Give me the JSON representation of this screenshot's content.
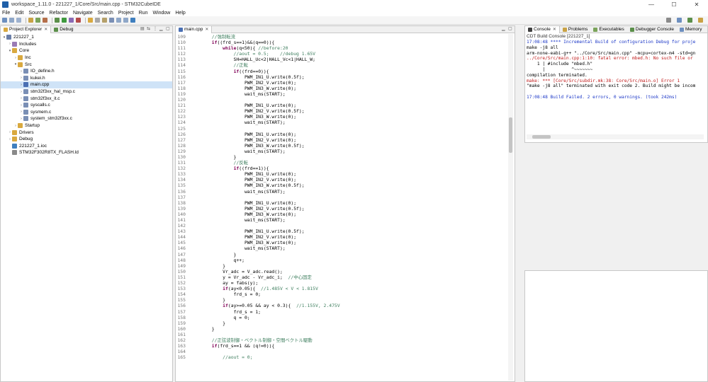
{
  "window": {
    "title": "workspace_1.11.0 - 221227_1/Core/Src/main.cpp - STM32CubeIDE",
    "minimize": "—",
    "maximize": "☐",
    "close": "✕"
  },
  "menu": [
    "File",
    "Edit",
    "Source",
    "Refactor",
    "Navigate",
    "Search",
    "Project",
    "Run",
    "Window",
    "Help"
  ],
  "explorer": {
    "tabs": [
      {
        "label": "Project Explorer"
      },
      {
        "label": "Debug"
      }
    ],
    "tree": [
      {
        "label": "221227_1",
        "depth": 0,
        "arrow": "▾",
        "icon": "project-icon",
        "color": "#6b7fa8"
      },
      {
        "label": "Includes",
        "depth": 1,
        "arrow": "›",
        "icon": "includes-icon",
        "color": "#9a7bb5"
      },
      {
        "label": "Core",
        "depth": 1,
        "arrow": "▾",
        "icon": "folder-icon",
        "color": "#d9a93f"
      },
      {
        "label": "Inc",
        "depth": 2,
        "arrow": "›",
        "icon": "folder-icon",
        "color": "#d9a93f"
      },
      {
        "label": "Src",
        "depth": 2,
        "arrow": "▾",
        "icon": "folder-icon",
        "color": "#d9a93f"
      },
      {
        "label": "IO_define.h",
        "depth": 3,
        "arrow": "›",
        "icon": "header-file-icon",
        "color": "#7a8fb5"
      },
      {
        "label": "kukei.h",
        "depth": 3,
        "arrow": "›",
        "icon": "header-file-icon",
        "color": "#7a8fb5"
      },
      {
        "label": "main.cpp",
        "depth": 3,
        "arrow": "›",
        "icon": "cpp-file-icon",
        "color": "#4a6fb3",
        "selected": true
      },
      {
        "label": "stm32f3xx_hal_msp.c",
        "depth": 3,
        "arrow": "›",
        "icon": "c-file-icon",
        "color": "#7a8fb5"
      },
      {
        "label": "stm32f3xx_it.c",
        "depth": 3,
        "arrow": "›",
        "icon": "c-file-icon",
        "color": "#7a8fb5"
      },
      {
        "label": "syscalls.c",
        "depth": 3,
        "arrow": "›",
        "icon": "c-file-icon",
        "color": "#7a8fb5"
      },
      {
        "label": "sysmem.c",
        "depth": 3,
        "arrow": "›",
        "icon": "c-file-icon",
        "color": "#7a8fb5"
      },
      {
        "label": "system_stm32f3xx.c",
        "depth": 3,
        "arrow": "›",
        "icon": "c-file-icon",
        "color": "#7a8fb5"
      },
      {
        "label": "Startup",
        "depth": 2,
        "arrow": "›",
        "icon": "folder-icon",
        "color": "#d9a93f"
      },
      {
        "label": "Drivers",
        "depth": 1,
        "arrow": "›",
        "icon": "folder-icon",
        "color": "#d9a93f"
      },
      {
        "label": "Debug",
        "depth": 1,
        "arrow": "›",
        "icon": "folder-icon",
        "color": "#d9a93f"
      },
      {
        "label": "221227_1.ioc",
        "depth": 1,
        "arrow": "",
        "icon": "ioc-file-icon",
        "color": "#3f7fbf"
      },
      {
        "label": "STM32F302R8TX_FLASH.ld",
        "depth": 1,
        "arrow": "",
        "icon": "ld-file-icon",
        "color": "#8a8a8a"
      }
    ]
  },
  "editor": {
    "tab": "main.cpp",
    "lines": [
      {
        "n": "109",
        "t": "        //強制転流",
        "k": "cm"
      },
      {
        "n": "110",
        "t": "        if((frd_s==1)&&(q==0)){",
        "k": "kw"
      },
      {
        "n": "111",
        "t": "            while(q<50){ //before:20",
        "k": "kw"
      },
      {
        "n": "112",
        "t": "                //aout = 0.5;    //debug 1.65V",
        "k": "cm"
      },
      {
        "n": "113",
        "t": "                SH=HALL_Uc<2|HALL_Vc<1|HALL_W;",
        "k": ""
      },
      {
        "n": "114",
        "t": "                //正転",
        "k": "cm"
      },
      {
        "n": "115",
        "t": "                if((frd==0)){",
        "k": "kw"
      },
      {
        "n": "116",
        "t": "                    PWM_IN1_U.write(0.5f);",
        "k": ""
      },
      {
        "n": "117",
        "t": "                    PWM_IN2_V.write(0);",
        "k": ""
      },
      {
        "n": "118",
        "t": "                    PWM_IN3_W.write(0);",
        "k": ""
      },
      {
        "n": "119",
        "t": "                    wait_ms(START);",
        "k": ""
      },
      {
        "n": "120",
        "t": "",
        "k": ""
      },
      {
        "n": "121",
        "t": "                    PWM_IN1_U.write(0);",
        "k": ""
      },
      {
        "n": "122",
        "t": "                    PWM_IN2_V.write(0.5f);",
        "k": ""
      },
      {
        "n": "123",
        "t": "                    PWM_IN3_W.write(0);",
        "k": ""
      },
      {
        "n": "124",
        "t": "                    wait_ms(START);",
        "k": ""
      },
      {
        "n": "125",
        "t": "",
        "k": ""
      },
      {
        "n": "126",
        "t": "                    PWM_IN1_U.write(0);",
        "k": ""
      },
      {
        "n": "127",
        "t": "                    PWM_IN2_V.write(0);",
        "k": ""
      },
      {
        "n": "128",
        "t": "                    PWM_IN3_W.write(0.5f);",
        "k": ""
      },
      {
        "n": "129",
        "t": "                    wait_ms(START);",
        "k": ""
      },
      {
        "n": "130",
        "t": "                }",
        "k": ""
      },
      {
        "n": "131",
        "t": "                //反転",
        "k": "cm"
      },
      {
        "n": "132",
        "t": "                if((frd==1)){",
        "k": "kw"
      },
      {
        "n": "133",
        "t": "                    PWM_IN1_U.write(0);",
        "k": ""
      },
      {
        "n": "134",
        "t": "                    PWM_IN2_V.write(0);",
        "k": ""
      },
      {
        "n": "135",
        "t": "                    PWM_IN3_W.write(0.5f);",
        "k": ""
      },
      {
        "n": "136",
        "t": "                    wait_ms(START);",
        "k": ""
      },
      {
        "n": "137",
        "t": "",
        "k": ""
      },
      {
        "n": "138",
        "t": "                    PWM_IN1_U.write(0);",
        "k": ""
      },
      {
        "n": "139",
        "t": "                    PWM_IN2_V.write(0.5f);",
        "k": ""
      },
      {
        "n": "140",
        "t": "                    PWM_IN3_W.write(0);",
        "k": ""
      },
      {
        "n": "141",
        "t": "                    wait_ms(START);",
        "k": ""
      },
      {
        "n": "142",
        "t": "",
        "k": ""
      },
      {
        "n": "143",
        "t": "                    PWM_IN1_U.write(0.5f);",
        "k": ""
      },
      {
        "n": "144",
        "t": "                    PWM_IN2_V.write(0);",
        "k": ""
      },
      {
        "n": "145",
        "t": "                    PWM_IN3_W.write(0);",
        "k": ""
      },
      {
        "n": "146",
        "t": "                    wait_ms(START);",
        "k": ""
      },
      {
        "n": "147",
        "t": "                }",
        "k": ""
      },
      {
        "n": "148",
        "t": "                q++;",
        "k": ""
      },
      {
        "n": "149",
        "t": "            }",
        "k": ""
      },
      {
        "n": "150",
        "t": "            Vr_adc = V_adc.read();",
        "k": ""
      },
      {
        "n": "151",
        "t": "            y = Vr_adc - Vr_adc_i;  //中心固定",
        "k": "mix"
      },
      {
        "n": "152",
        "t": "            ay = fabs(y);",
        "k": ""
      },
      {
        "n": "153",
        "t": "            if(ay<0.05){  //1.485V < V < 1.815V",
        "k": "mix"
      },
      {
        "n": "154",
        "t": "                frd_s = 0;",
        "k": ""
      },
      {
        "n": "155",
        "t": "            }",
        "k": ""
      },
      {
        "n": "156",
        "t": "            if(ay>=0.05 && ay < 0.3){  //1.155V, 2.475V",
        "k": "mix"
      },
      {
        "n": "157",
        "t": "                frd_s = 1;",
        "k": ""
      },
      {
        "n": "158",
        "t": "                q = 0;",
        "k": ""
      },
      {
        "n": "159",
        "t": "            }",
        "k": ""
      },
      {
        "n": "160",
        "t": "        }",
        "k": ""
      },
      {
        "n": "161",
        "t": "",
        "k": ""
      },
      {
        "n": "162",
        "t": "        //正弦波制御・ベクトル制御・空間ベクトル駆動",
        "k": "cm"
      },
      {
        "n": "163",
        "t": "        if(frd_s==1 && (q!=0)){",
        "k": "kw"
      },
      {
        "n": "164",
        "t": "",
        "k": ""
      },
      {
        "n": "165",
        "t": "            //aout = 0;",
        "k": "cm"
      }
    ]
  },
  "console": {
    "tabs": [
      {
        "label": "Console"
      },
      {
        "label": "Problems"
      },
      {
        "label": "Executables"
      },
      {
        "label": "Debugger Console"
      },
      {
        "label": "Memory"
      }
    ],
    "header": "CDT Build Console [221227_1]",
    "lines": [
      {
        "t": "17:08:48 **** Incremental Build of configuration Debug for proje",
        "c": "c-blue"
      },
      {
        "t": "make -j8 all",
        "c": "c-black"
      },
      {
        "t": "arm-none-eabi-g++ \"../Core/Src/main.cpp\" -mcpu=cortex-m4 -std=gn",
        "c": "c-black"
      },
      {
        "t": "../Core/Src/main.cpp:1:10: fatal error: mbed.h: No such file or",
        "c": "c-red"
      },
      {
        "t": "    1 | #include \"mbed.h\"",
        "c": "c-black"
      },
      {
        "t": "      |          ^~~~~~~~",
        "c": "c-black"
      },
      {
        "t": "compilation terminated.",
        "c": "c-black"
      },
      {
        "t": "make: *** [Core/Src/subdir.mk:38: Core/Src/main.o] Error 1",
        "c": "c-red"
      },
      {
        "t": "\"make -j8 all\" terminated with exit code 2. Build might be incom",
        "c": "c-black"
      },
      {
        "t": "",
        "c": "c-black"
      },
      {
        "t": "17:08:48 Build Failed. 2 errors, 0 warnings. (took 242ms)",
        "c": "c-blue"
      }
    ]
  },
  "colors": {
    "accent": "#1f5fa8",
    "selection": "#cfe3f7",
    "keyword": "#7f0055",
    "comment": "#3f7f5f",
    "error": "#c01a1a",
    "info": "#1a36c7"
  }
}
